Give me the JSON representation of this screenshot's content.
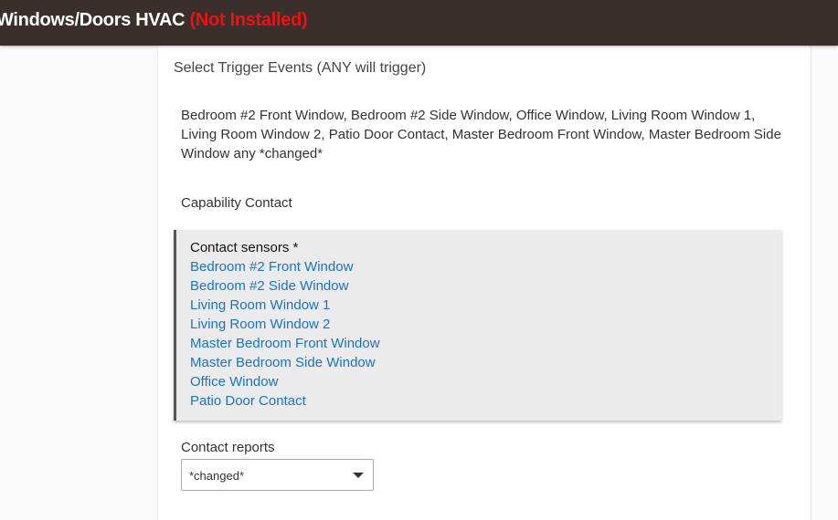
{
  "header": {
    "title": "Windows/Doors HVAC",
    "status": "(Not Installed)"
  },
  "section_title": "Select Trigger Events (ANY will trigger)",
  "trigger_description": "Bedroom #2 Front Window, Bedroom #2 Side Window, Office Window, Living Room Window 1, Living Room Window 2, Patio Door Contact, Master Bedroom Front Window, Master Bedroom Side Window any *changed*",
  "capability": "Capability Contact",
  "sensors": {
    "label": "Contact sensors *",
    "items": [
      "Bedroom #2 Front Window",
      "Bedroom #2 Side Window",
      "Living Room Window 1",
      "Living Room Window 2",
      "Master Bedroom Front Window",
      "Master Bedroom Side Window",
      "Office Window",
      "Patio Door Contact"
    ]
  },
  "reports": {
    "label": "Contact reports",
    "value": "*changed*"
  }
}
